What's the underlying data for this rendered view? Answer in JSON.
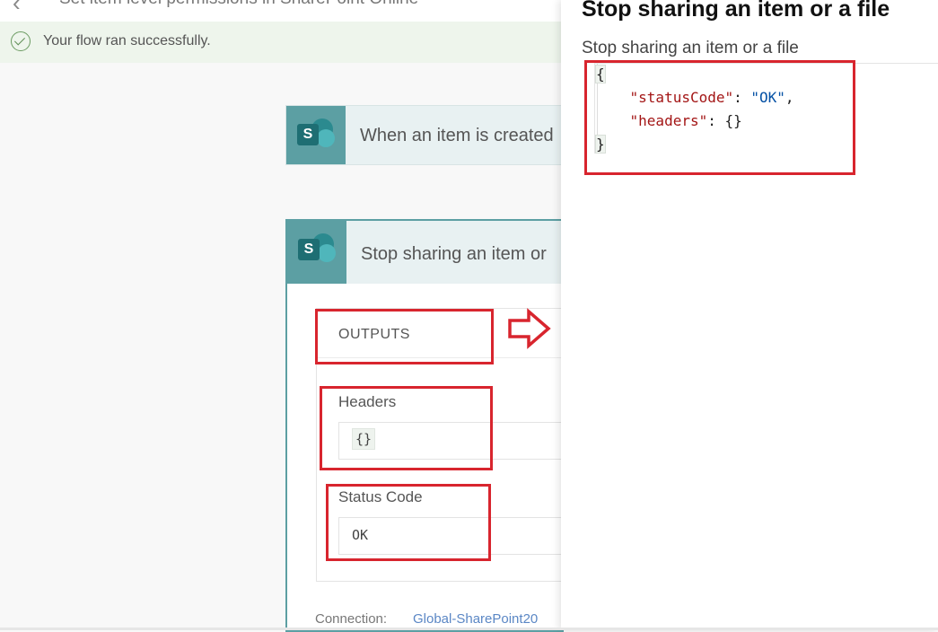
{
  "header": {
    "flow_title": "Set item level permissions in SharePoint Online"
  },
  "banner": {
    "message": "Your flow ran successfully."
  },
  "steps": {
    "trigger": {
      "title": "When an item is created"
    },
    "action": {
      "title": "Stop sharing an item or",
      "outputs_label": "OUTPUTS",
      "headers_label": "Headers",
      "headers_value": "{}",
      "status_code_label": "Status Code",
      "status_code_value": "OK",
      "connection_label": "Connection:",
      "connection_value": "Global-SharePoint20"
    }
  },
  "panel": {
    "title": "Stop sharing an item or a file",
    "subtitle": "Stop sharing an item or a file",
    "code": {
      "open_brace": "{",
      "status_key": "\"statusCode\"",
      "status_value": "\"OK\"",
      "headers_key": "\"headers\"",
      "headers_value": "{}",
      "close_brace": "}"
    }
  },
  "colors": {
    "annotation": "#d8252e",
    "sharepoint": "#5c9fa3",
    "success_bg": "#eef5ec",
    "link": "#5b87c5"
  },
  "icons": {
    "back": "chevron-left-icon",
    "success": "checkmark-circle-icon",
    "connector": "sharepoint-icon",
    "arrow": "arrow-right-icon"
  }
}
